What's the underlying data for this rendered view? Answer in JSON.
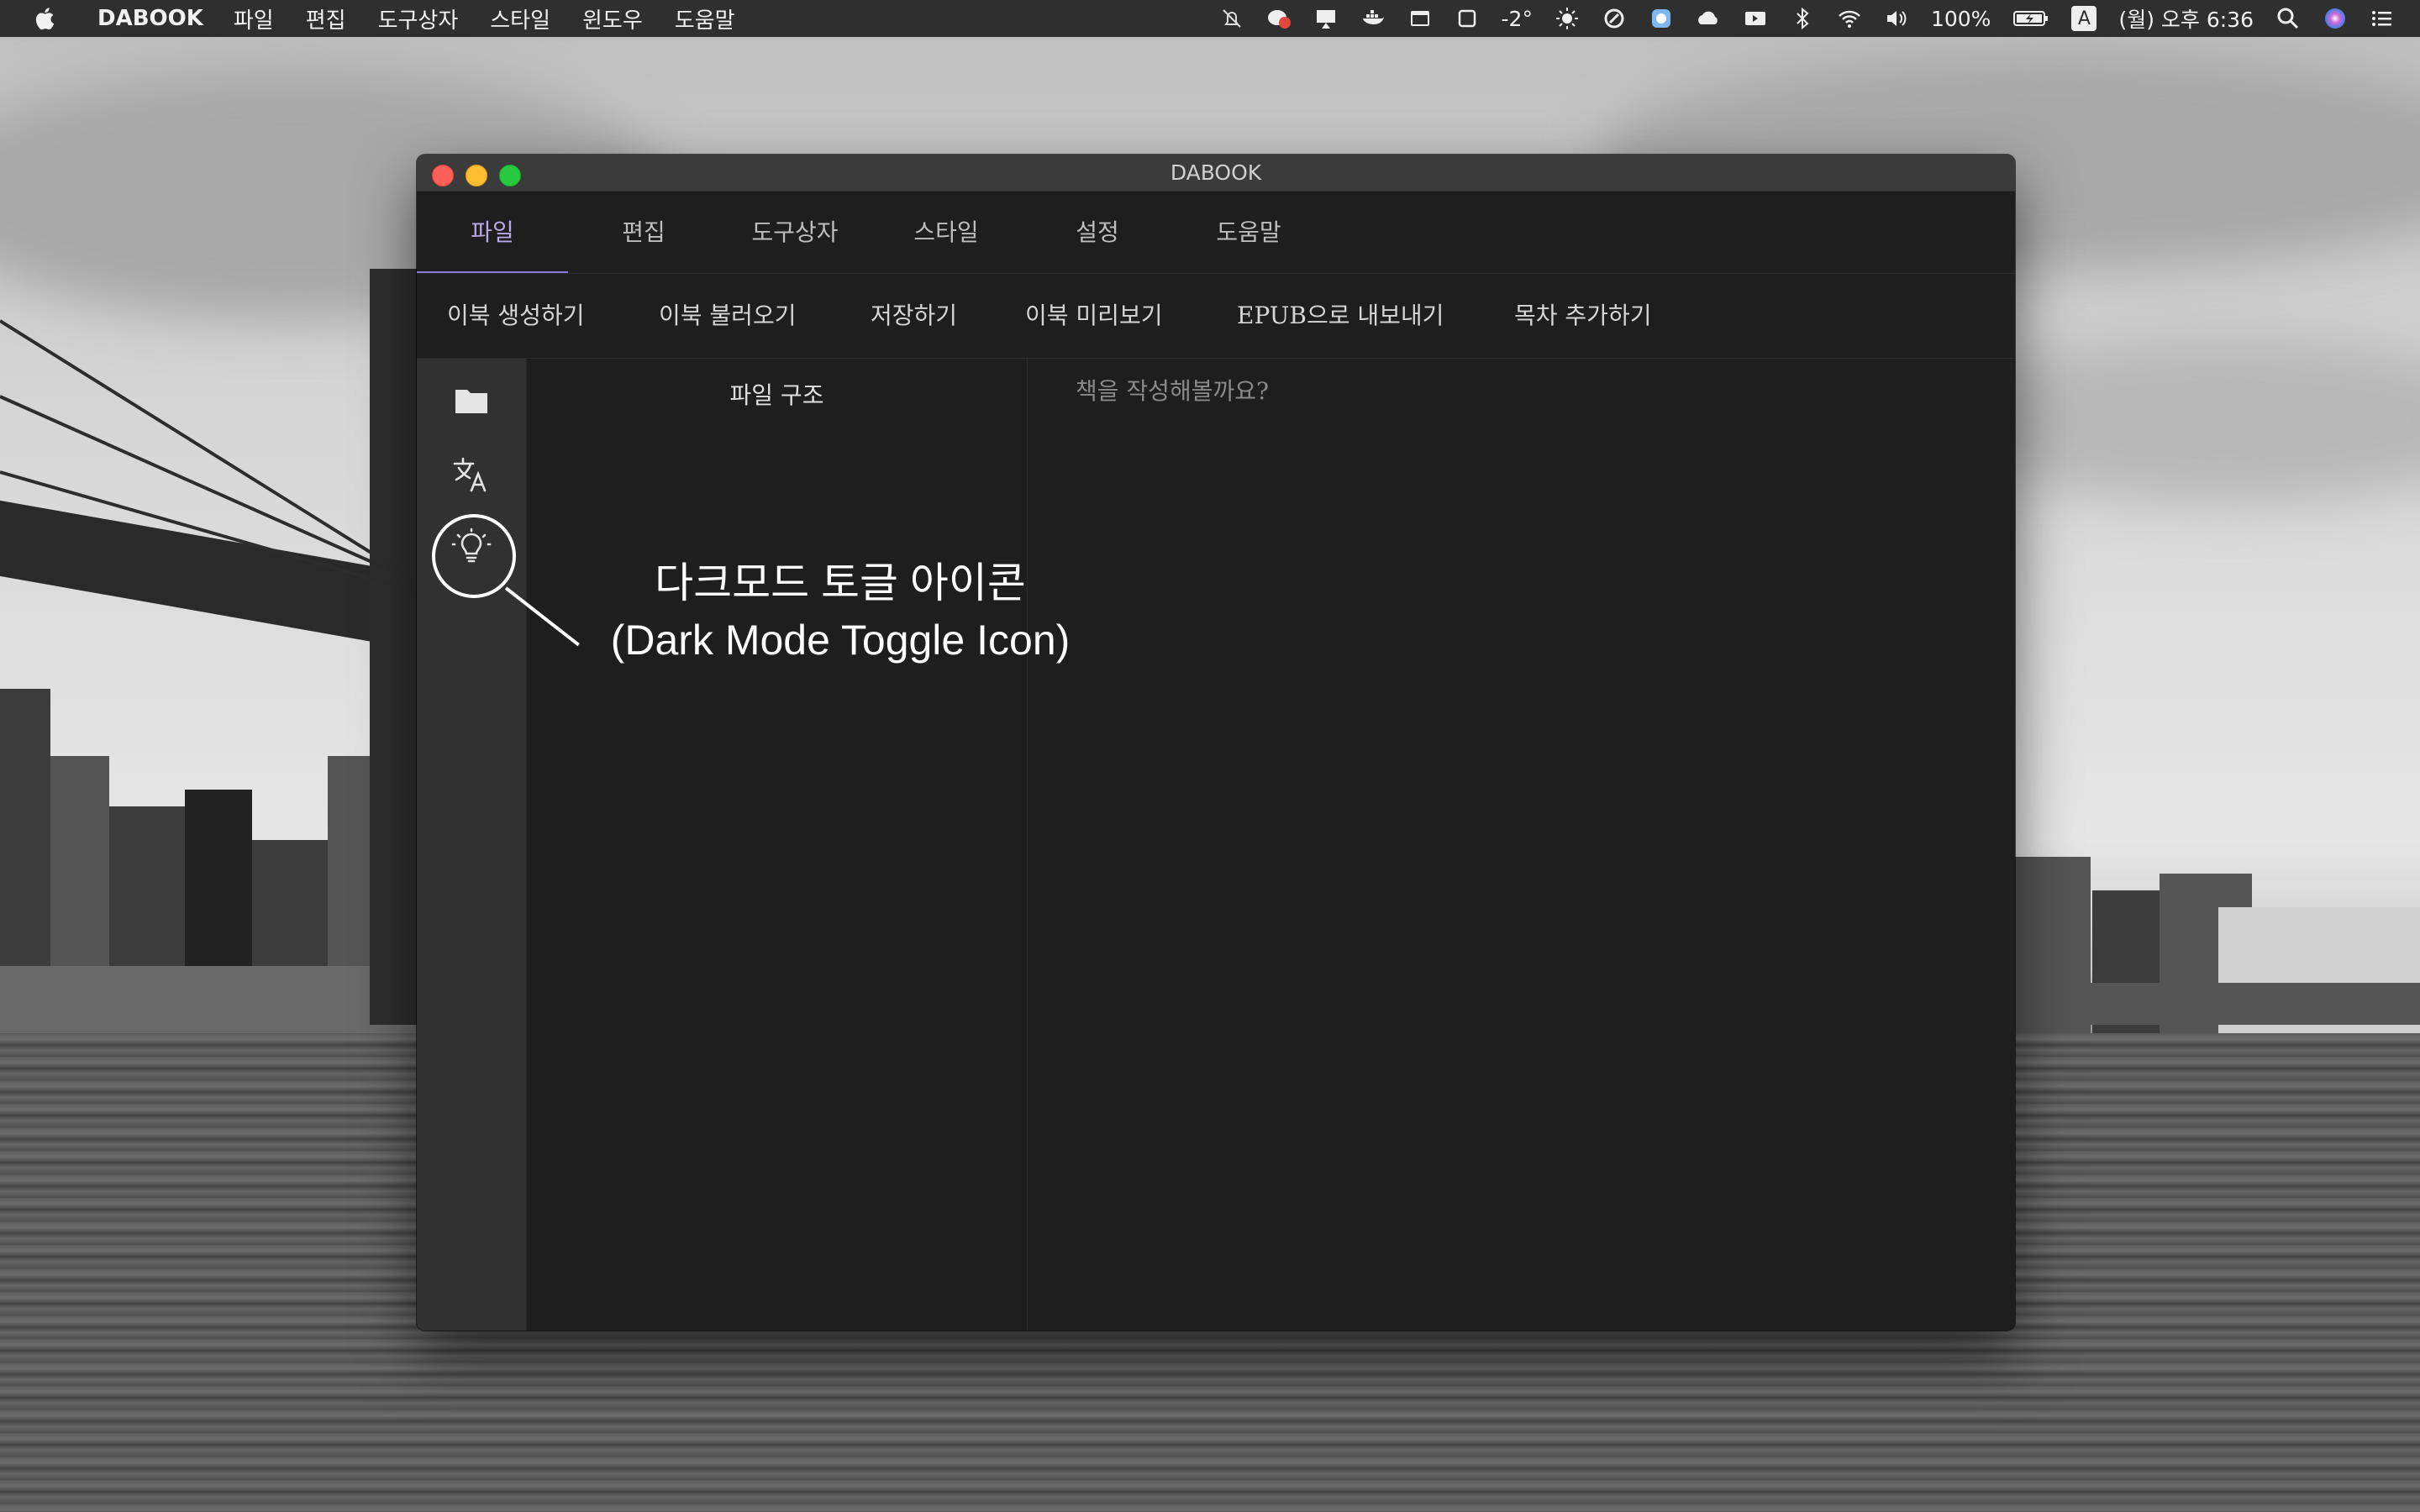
{
  "menubar": {
    "app_name": "DABOOK",
    "menus": [
      "파일",
      "편집",
      "도구상자",
      "스타일",
      "윈도우",
      "도움말"
    ],
    "temperature": "-2°",
    "battery": "100%",
    "input_source": "A",
    "clock": "(월) 오후 6:36"
  },
  "window": {
    "title": "DABOOK"
  },
  "tabs": {
    "items": [
      {
        "label": "파일",
        "active": true
      },
      {
        "label": "편집",
        "active": false
      },
      {
        "label": "도구상자",
        "active": false
      },
      {
        "label": "스타일",
        "active": false
      },
      {
        "label": "설정",
        "active": false
      },
      {
        "label": "도움말",
        "active": false
      }
    ]
  },
  "toolbar": {
    "items": [
      {
        "label": "이북 생성하기"
      },
      {
        "label": "이북 불러오기"
      },
      {
        "label": "저장하기"
      },
      {
        "label": "이북 미리보기"
      },
      {
        "label": "EPUB으로 내보내기"
      },
      {
        "label": "목차 추가하기"
      }
    ]
  },
  "sidebar": {
    "icons": [
      "folder-icon",
      "translate-icon",
      "lightbulb-icon"
    ]
  },
  "file_tree": {
    "title": "파일 구조"
  },
  "editor": {
    "placeholder": "책을 작성해볼까요?",
    "value": ""
  },
  "annotation": {
    "line1": "다크모드 토글 아이콘",
    "line2": "(Dark Mode Toggle Icon)"
  },
  "colors": {
    "accent": "#8b7ad6",
    "active_tab_text": "#b8a8e6",
    "window_bg": "#1e1e1e",
    "sidebar_bg": "#313131",
    "titlebar_bg": "#3b3b3b"
  }
}
